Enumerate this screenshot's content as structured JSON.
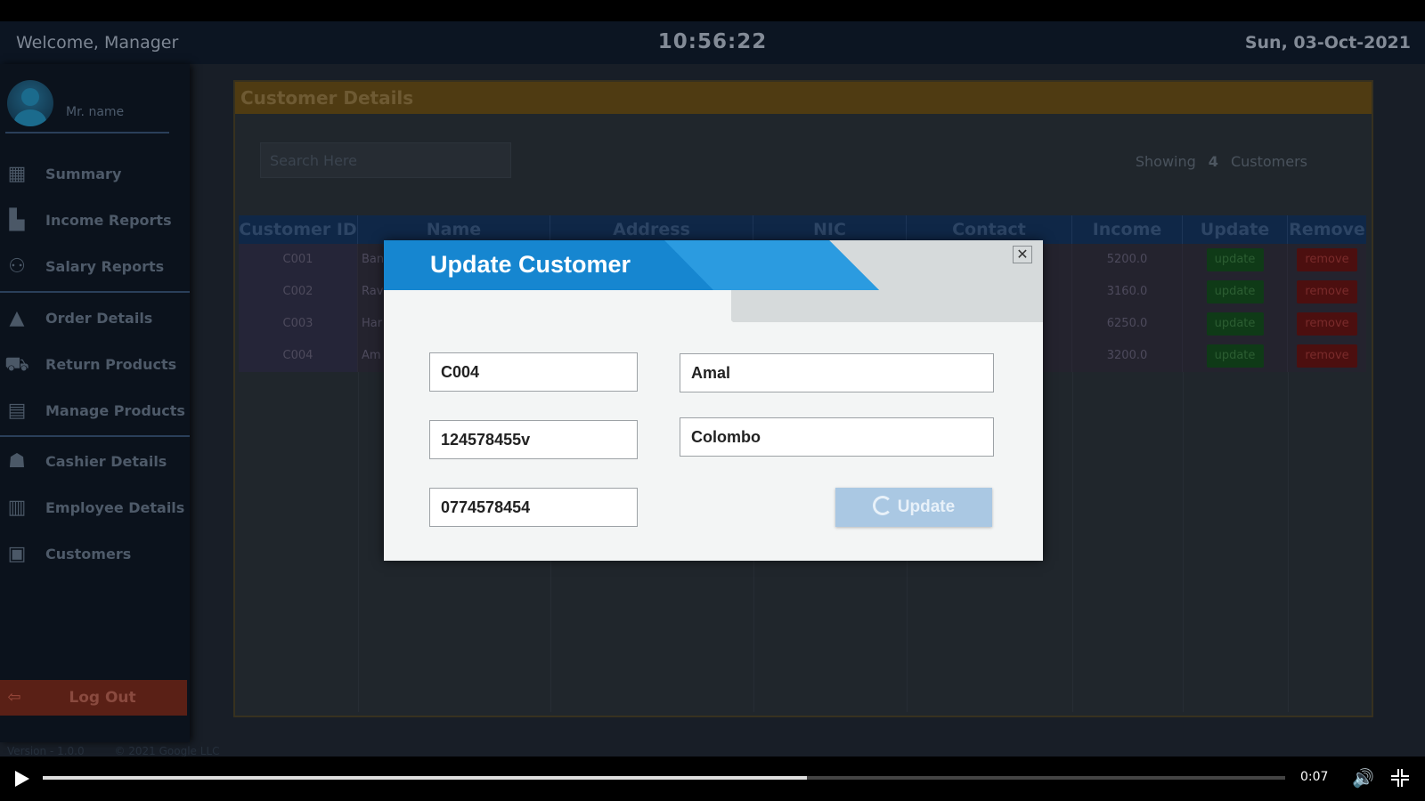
{
  "topbar": {
    "welcome": "Welcome, Manager",
    "time": "10:56:22",
    "date": "Sun, 03-Oct-2021"
  },
  "sidebar": {
    "user_name": "Mr. name",
    "items": [
      {
        "label": "Summary",
        "icon": "summary-icon",
        "glyph": "▦"
      },
      {
        "label": "Income Reports",
        "icon": "income-reports-icon",
        "glyph": "▙"
      },
      {
        "label": "Salary Reports",
        "icon": "salary-reports-icon",
        "glyph": "⚇"
      },
      {
        "label": "Order Details",
        "icon": "order-details-icon",
        "glyph": "▲"
      },
      {
        "label": "Return Products",
        "icon": "return-products-icon",
        "glyph": "⛟"
      },
      {
        "label": "Manage Products",
        "icon": "manage-products-icon",
        "glyph": "▤"
      },
      {
        "label": "Cashier Details",
        "icon": "cashier-details-icon",
        "glyph": "☗"
      },
      {
        "label": "Employee Details",
        "icon": "employee-details-icon",
        "glyph": "▥"
      },
      {
        "label": "Customers",
        "icon": "customers-icon",
        "glyph": "▣"
      }
    ],
    "logout_label": "Log Out",
    "version": "Version - 1.0.0",
    "copyright": "© 2021 Google LLC"
  },
  "panel": {
    "title": "Customer Details",
    "search_placeholder": "Search Here",
    "showing_prefix": "Showing",
    "showing_count": "4",
    "showing_suffix": "Customers",
    "columns": [
      "Customer ID",
      "Name",
      "Address",
      "NIC",
      "Contact",
      "Income",
      "Update",
      "Remove"
    ],
    "rows": [
      {
        "id": "C001",
        "name": "Ban",
        "address": "",
        "nic": "",
        "contact": "",
        "income": "5200.0",
        "update": "update",
        "remove": "remove"
      },
      {
        "id": "C002",
        "name": "Rav",
        "address": "",
        "nic": "",
        "contact": "",
        "income": "3160.0",
        "update": "update",
        "remove": "remove"
      },
      {
        "id": "C003",
        "name": "Har",
        "address": "",
        "nic": "",
        "contact": "",
        "income": "6250.0",
        "update": "update",
        "remove": "remove"
      },
      {
        "id": "C004",
        "name": "Am",
        "address": "",
        "nic": "",
        "contact": "",
        "income": "3200.0",
        "update": "update",
        "remove": "remove"
      }
    ]
  },
  "modal": {
    "title": "Update Customer",
    "close_glyph": "✕",
    "customer_id": "C004",
    "name": "Amal",
    "nic": "124578455v",
    "address": "Colombo",
    "contact": "0774578454",
    "update_label": "Update"
  },
  "video": {
    "time": "0:07",
    "progress": 0.615,
    "volume_glyph": "🔊"
  },
  "colors": {
    "accent_blue": "#1686d0",
    "header_orange": "#4f3b12",
    "update_green": "#0f3a17",
    "remove_red": "#4c0f0f"
  }
}
